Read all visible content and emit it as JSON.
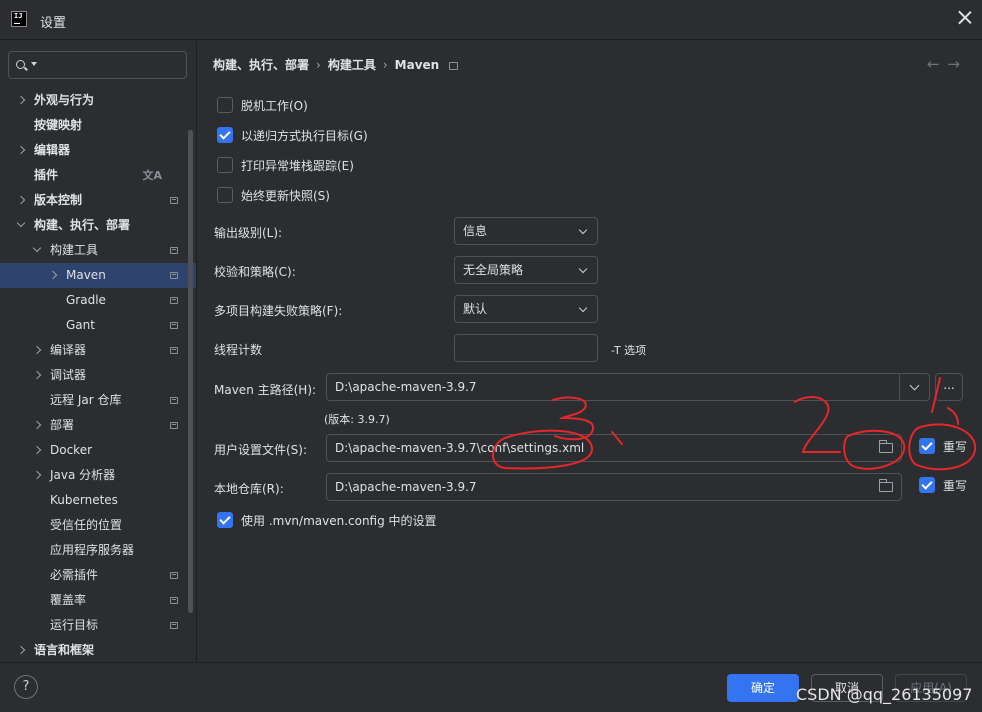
{
  "window": {
    "title": "设置",
    "logo_text": "IJ"
  },
  "search": {
    "placeholder": ""
  },
  "sidebar": {
    "items": [
      {
        "label": "外观与行为",
        "expander": "right",
        "bold": true
      },
      {
        "label": "按键映射",
        "expander": "none",
        "bold": true
      },
      {
        "label": "编辑器",
        "expander": "right",
        "bold": true
      },
      {
        "label": "插件",
        "expander": "none",
        "bold": true,
        "icon": "translate-icon"
      },
      {
        "label": "版本控制",
        "expander": "right",
        "bold": true,
        "icon": "project-icon"
      },
      {
        "label": "构建、执行、部署",
        "expander": "down",
        "bold": true
      },
      {
        "label": "构建工具",
        "expander": "down",
        "bold": false,
        "icon": "project-icon"
      },
      {
        "label": "Maven",
        "expander": "right",
        "bold": false,
        "icon": "project-icon",
        "selected": true
      },
      {
        "label": "Gradle",
        "expander": "none",
        "bold": false,
        "icon": "project-icon"
      },
      {
        "label": "Gant",
        "expander": "none",
        "bold": false,
        "icon": "project-icon"
      },
      {
        "label": "编译器",
        "expander": "right",
        "bold": false,
        "icon": "project-icon"
      },
      {
        "label": "调试器",
        "expander": "right",
        "bold": false
      },
      {
        "label": "远程 Jar 仓库",
        "expander": "none",
        "bold": false,
        "icon": "project-icon"
      },
      {
        "label": "部署",
        "expander": "right",
        "bold": false,
        "icon": "project-icon"
      },
      {
        "label": "Docker",
        "expander": "right",
        "bold": false
      },
      {
        "label": "Java 分析器",
        "expander": "right",
        "bold": false
      },
      {
        "label": "Kubernetes",
        "expander": "none",
        "bold": false
      },
      {
        "label": "受信任的位置",
        "expander": "none",
        "bold": false
      },
      {
        "label": "应用程序服务器",
        "expander": "none",
        "bold": false
      },
      {
        "label": "必需插件",
        "expander": "none",
        "bold": false,
        "icon": "project-icon"
      },
      {
        "label": "覆盖率",
        "expander": "none",
        "bold": false,
        "icon": "project-icon"
      },
      {
        "label": "运行目标",
        "expander": "none",
        "bold": false,
        "icon": "project-icon"
      },
      {
        "label": "语言和框架",
        "expander": "right",
        "bold": true
      }
    ]
  },
  "breadcrumb": {
    "part1": "构建、执行、部署",
    "part2": "构建工具",
    "part3": "Maven",
    "sep": "›"
  },
  "nav": {
    "back": "←",
    "forward": "→"
  },
  "options": {
    "offline": {
      "label": "脱机工作(O)",
      "checked": false
    },
    "recursive": {
      "label": "以递归方式执行目标(G)",
      "checked": true
    },
    "print_stack": {
      "label": "打印异常堆栈跟踪(E)",
      "checked": false
    },
    "always_update": {
      "label": "始终更新快照(S)",
      "checked": false
    }
  },
  "fields": {
    "output_level": {
      "label": "输出级别(L):",
      "value": "信息"
    },
    "checksum_policy": {
      "label": "校验和策略(C):",
      "value": "无全局策略"
    },
    "multiproject_fail": {
      "label": "多项目构建失败策略(F):",
      "value": "默认"
    },
    "thread_count": {
      "label": "线程计数",
      "value": "",
      "hint": "-T 选项"
    },
    "maven_home": {
      "label": "Maven 主路径(H):",
      "value": "D:\\apache-maven-3.9.7",
      "version": "(版本: 3.9.7)",
      "browse": "..."
    },
    "user_settings": {
      "label": "用户设置文件(S):",
      "value": "D:\\apache-maven-3.9.7\\conf\\settings.xml",
      "override_label": "重写",
      "override": true
    },
    "local_repo": {
      "label": "本地仓库(R):",
      "value": "D:\\apache-maven-3.9.7",
      "override_label": "重写",
      "override": true
    },
    "use_mvn_config": {
      "label": "使用 .mvn/maven.config 中的设置",
      "checked": true
    }
  },
  "footer": {
    "help": "?",
    "ok": "确定",
    "cancel": "取消",
    "apply": "应用(A)"
  },
  "watermark": "CSDN @qq_26135097",
  "annotations": {
    "mark1": "1",
    "mark2": "2",
    "mark3": "3",
    "color": "#e5262b"
  },
  "colors": {
    "accent": "#3574f0",
    "selected_row": "#2e436e",
    "background": "#2b2d30"
  }
}
